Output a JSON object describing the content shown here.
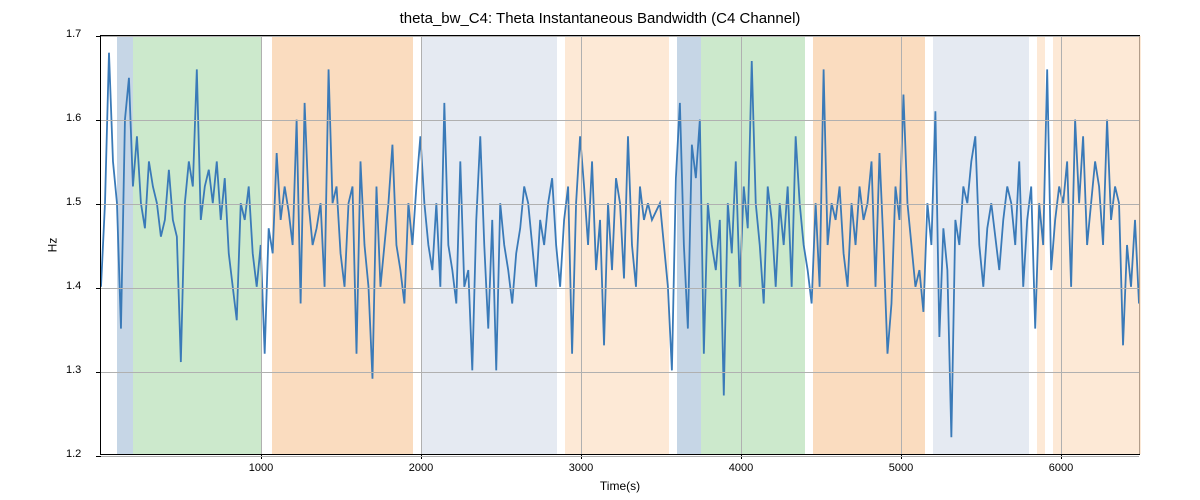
{
  "chart_data": {
    "type": "line",
    "title": "theta_bw_C4: Theta Instantaneous Bandwidth (C4 Channel)",
    "xlabel": "Time(s)",
    "ylabel": "Hz",
    "xlim": [
      0,
      6500
    ],
    "ylim": [
      1.2,
      1.7
    ],
    "xticks": [
      1000,
      2000,
      3000,
      4000,
      5000,
      6000
    ],
    "yticks": [
      1.2,
      1.3,
      1.4,
      1.5,
      1.6,
      1.7
    ],
    "bands": [
      {
        "start": 100,
        "end": 200,
        "color": "#b8cce0",
        "opacity": 0.8
      },
      {
        "start": 200,
        "end": 1000,
        "color": "#b7e0b7",
        "opacity": 0.7
      },
      {
        "start": 1070,
        "end": 1950,
        "color": "#f5c08a",
        "opacity": 0.55
      },
      {
        "start": 2000,
        "end": 2850,
        "color": "#d3dce9",
        "opacity": 0.6
      },
      {
        "start": 2900,
        "end": 3550,
        "color": "#fce0c5",
        "opacity": 0.7
      },
      {
        "start": 3600,
        "end": 3750,
        "color": "#b8cce0",
        "opacity": 0.8
      },
      {
        "start": 3750,
        "end": 4400,
        "color": "#b7e0b7",
        "opacity": 0.7
      },
      {
        "start": 4450,
        "end": 5150,
        "color": "#f5c08a",
        "opacity": 0.55
      },
      {
        "start": 5200,
        "end": 5800,
        "color": "#d3dce9",
        "opacity": 0.6
      },
      {
        "start": 5850,
        "end": 5900,
        "color": "#fce0c5",
        "opacity": 0.7
      },
      {
        "start": 5950,
        "end": 6500,
        "color": "#fce0c5",
        "opacity": 0.7
      }
    ],
    "series": [
      {
        "name": "theta_bw_C4",
        "color": "#3a7ab8",
        "x": [
          0,
          25,
          50,
          75,
          100,
          125,
          150,
          175,
          200,
          225,
          250,
          275,
          300,
          325,
          350,
          375,
          400,
          425,
          450,
          475,
          500,
          525,
          550,
          575,
          600,
          625,
          650,
          675,
          700,
          725,
          750,
          775,
          800,
          825,
          850,
          875,
          900,
          925,
          950,
          975,
          1000,
          1025,
          1050,
          1075,
          1100,
          1125,
          1150,
          1175,
          1200,
          1225,
          1250,
          1275,
          1300,
          1325,
          1350,
          1375,
          1400,
          1425,
          1450,
          1475,
          1500,
          1525,
          1550,
          1575,
          1600,
          1625,
          1650,
          1675,
          1700,
          1725,
          1750,
          1775,
          1800,
          1825,
          1850,
          1875,
          1900,
          1925,
          1950,
          1975,
          2000,
          2025,
          2050,
          2075,
          2100,
          2125,
          2150,
          2175,
          2200,
          2225,
          2250,
          2275,
          2300,
          2325,
          2350,
          2375,
          2400,
          2425,
          2450,
          2475,
          2500,
          2525,
          2550,
          2575,
          2600,
          2625,
          2650,
          2675,
          2700,
          2725,
          2750,
          2775,
          2800,
          2825,
          2850,
          2875,
          2900,
          2925,
          2950,
          2975,
          3000,
          3025,
          3050,
          3075,
          3100,
          3125,
          3150,
          3175,
          3200,
          3225,
          3250,
          3275,
          3300,
          3325,
          3350,
          3375,
          3400,
          3425,
          3450,
          3475,
          3500,
          3525,
          3550,
          3575,
          3600,
          3625,
          3650,
          3675,
          3700,
          3725,
          3750,
          3775,
          3800,
          3825,
          3850,
          3875,
          3900,
          3925,
          3950,
          3975,
          4000,
          4025,
          4050,
          4075,
          4100,
          4125,
          4150,
          4175,
          4200,
          4225,
          4250,
          4275,
          4300,
          4325,
          4350,
          4375,
          4400,
          4425,
          4450,
          4475,
          4500,
          4525,
          4550,
          4575,
          4600,
          4625,
          4650,
          4675,
          4700,
          4725,
          4750,
          4775,
          4800,
          4825,
          4850,
          4875,
          4900,
          4925,
          4950,
          4975,
          5000,
          5025,
          5050,
          5075,
          5100,
          5125,
          5150,
          5175,
          5200,
          5225,
          5250,
          5275,
          5300,
          5325,
          5350,
          5375,
          5400,
          5425,
          5450,
          5475,
          5500,
          5525,
          5550,
          5575,
          5600,
          5625,
          5650,
          5675,
          5700,
          5725,
          5750,
          5775,
          5800,
          5825,
          5850,
          5875,
          5900,
          5925,
          5950,
          5975,
          6000,
          6025,
          6050,
          6075,
          6100,
          6125,
          6150,
          6175,
          6200,
          6225,
          6250,
          6275,
          6300,
          6325,
          6350,
          6375,
          6400,
          6425,
          6450,
          6475,
          6500
        ],
        "values": [
          1.4,
          1.5,
          1.68,
          1.55,
          1.5,
          1.35,
          1.6,
          1.65,
          1.52,
          1.58,
          1.5,
          1.47,
          1.55,
          1.52,
          1.5,
          1.46,
          1.48,
          1.54,
          1.48,
          1.46,
          1.31,
          1.5,
          1.55,
          1.52,
          1.66,
          1.48,
          1.52,
          1.54,
          1.5,
          1.55,
          1.48,
          1.53,
          1.44,
          1.4,
          1.36,
          1.5,
          1.48,
          1.52,
          1.44,
          1.4,
          1.45,
          1.32,
          1.47,
          1.44,
          1.56,
          1.48,
          1.52,
          1.49,
          1.45,
          1.6,
          1.38,
          1.62,
          1.5,
          1.45,
          1.47,
          1.5,
          1.4,
          1.66,
          1.5,
          1.52,
          1.44,
          1.4,
          1.5,
          1.52,
          1.32,
          1.55,
          1.45,
          1.4,
          1.29,
          1.52,
          1.4,
          1.45,
          1.5,
          1.57,
          1.45,
          1.42,
          1.38,
          1.5,
          1.45,
          1.52,
          1.58,
          1.5,
          1.45,
          1.42,
          1.5,
          1.4,
          1.62,
          1.45,
          1.42,
          1.38,
          1.55,
          1.4,
          1.42,
          1.3,
          1.48,
          1.58,
          1.45,
          1.35,
          1.48,
          1.3,
          1.5,
          1.45,
          1.42,
          1.38,
          1.44,
          1.47,
          1.52,
          1.5,
          1.45,
          1.4,
          1.48,
          1.45,
          1.5,
          1.53,
          1.45,
          1.4,
          1.48,
          1.52,
          1.32,
          1.5,
          1.58,
          1.52,
          1.45,
          1.55,
          1.42,
          1.48,
          1.33,
          1.5,
          1.42,
          1.53,
          1.5,
          1.41,
          1.58,
          1.45,
          1.4,
          1.52,
          1.48,
          1.5,
          1.48,
          1.49,
          1.5,
          1.45,
          1.4,
          1.3,
          1.53,
          1.62,
          1.45,
          1.35,
          1.57,
          1.53,
          1.6,
          1.32,
          1.5,
          1.45,
          1.42,
          1.48,
          1.27,
          1.5,
          1.44,
          1.55,
          1.4,
          1.52,
          1.47,
          1.67,
          1.5,
          1.45,
          1.38,
          1.52,
          1.48,
          1.4,
          1.5,
          1.45,
          1.52,
          1.4,
          1.58,
          1.5,
          1.45,
          1.42,
          1.38,
          1.5,
          1.4,
          1.66,
          1.45,
          1.5,
          1.48,
          1.52,
          1.44,
          1.4,
          1.5,
          1.45,
          1.52,
          1.48,
          1.5,
          1.55,
          1.4,
          1.56,
          1.45,
          1.32,
          1.38,
          1.52,
          1.48,
          1.63,
          1.5,
          1.45,
          1.4,
          1.42,
          1.37,
          1.5,
          1.45,
          1.61,
          1.34,
          1.47,
          1.42,
          1.22,
          1.48,
          1.45,
          1.52,
          1.5,
          1.55,
          1.58,
          1.45,
          1.4,
          1.47,
          1.5,
          1.46,
          1.42,
          1.48,
          1.52,
          1.5,
          1.45,
          1.55,
          1.4,
          1.48,
          1.52,
          1.35,
          1.5,
          1.45,
          1.66,
          1.42,
          1.48,
          1.52,
          1.5,
          1.55,
          1.4,
          1.6,
          1.5,
          1.58,
          1.45,
          1.5,
          1.55,
          1.52,
          1.45,
          1.6,
          1.48,
          1.52,
          1.5,
          1.33,
          1.45,
          1.4,
          1.48,
          1.38
        ]
      }
    ]
  }
}
